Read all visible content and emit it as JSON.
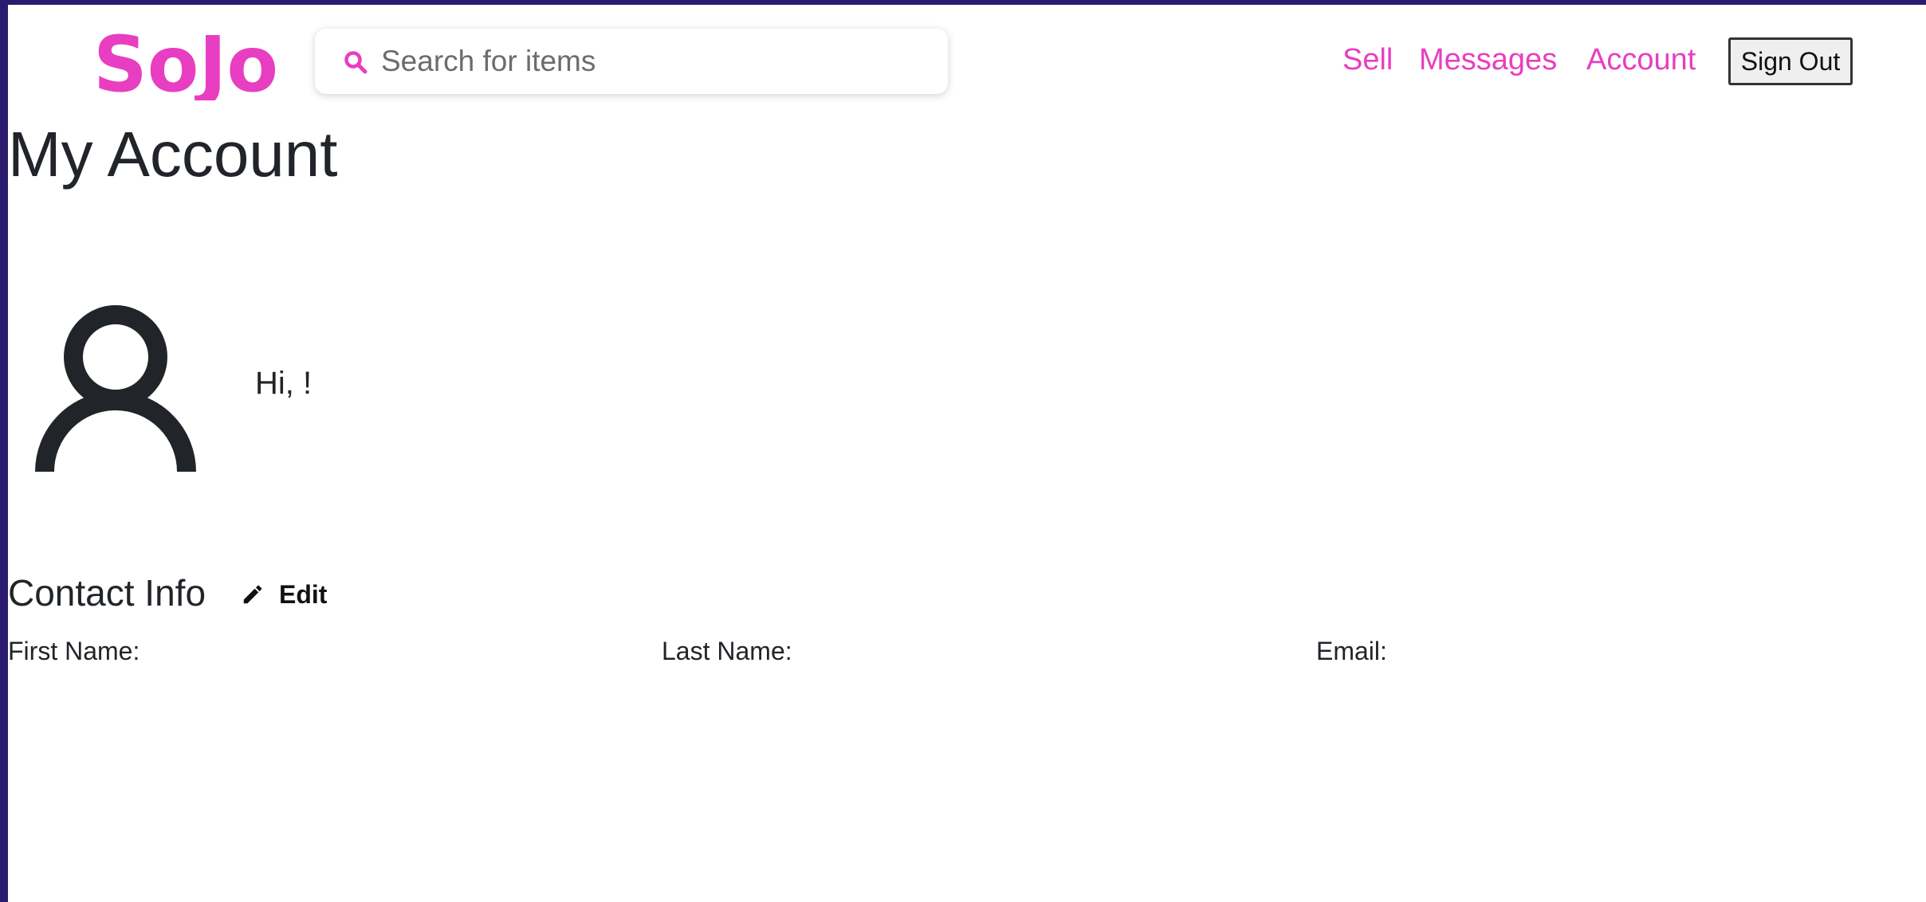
{
  "header": {
    "logo_text": "SoJo",
    "search": {
      "placeholder": "Search for items",
      "value": "",
      "icon": "search-icon"
    },
    "nav": {
      "sell": "Sell",
      "messages": "Messages",
      "account": "Account"
    },
    "sign_out_label": "Sign Out"
  },
  "main": {
    "title": "My Account",
    "avatar_icon": "user-icon",
    "greeting": "Hi, !",
    "contact": {
      "title": "Contact Info",
      "edit_icon": "pencil-icon",
      "edit_label": "Edit",
      "first_name_label": "First Name:",
      "last_name_label": "Last Name:",
      "email_label": "Email:"
    }
  },
  "colors": {
    "brand": "#e83ec1",
    "text": "#212529",
    "frame": "#2a1b6e"
  }
}
